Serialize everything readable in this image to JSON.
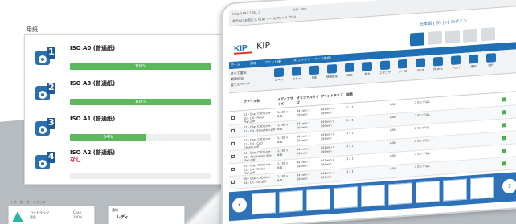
{
  "paper": {
    "title": "用紙",
    "trays": [
      {
        "number": "1",
        "name": "ISO A0 (普通紙)",
        "percent": 100,
        "label": "100%",
        "warning": ""
      },
      {
        "number": "2",
        "name": "ISO A3 (普通紙)",
        "percent": 100,
        "label": "100%",
        "warning": ""
      },
      {
        "number": "3",
        "name": "ISO A1 (普通紙)",
        "percent": 54,
        "label": "54%",
        "warning": ""
      },
      {
        "number": "4",
        "name": "ISO A2 (普通紙)",
        "percent": 0,
        "label": "",
        "warning": "なし"
      }
    ],
    "accent": "#5cb85c"
  },
  "cartridge": {
    "title": "トナー缶・カートリッジ",
    "name": "カートリッジ",
    "sub": "黒色",
    "cyan": "Cyan",
    "cyan_pct": "100%"
  },
  "notice": {
    "title": "通知",
    "status": "レディ"
  },
  "browser": {
    "address": "http://192.168.../",
    "tab": "KIP - Pro...",
    "menu": "表示(V)  お気に入り(A)  ツール(T)  ヘルプ(H)"
  },
  "app": {
    "logo": "KIP",
    "title": "KIP",
    "lang": "日本語 | EN | ▾ | ログイン",
    "tabs": [
      "ホーム",
      "保存",
      "プリント後",
      "ネ ファイル（ページ選択）"
    ],
    "toolbar": [
      "ページ",
      "カラー",
      "分割",
      "詳細設定",
      "回転",
      "拡大",
      "スタンプ",
      "サイズ",
      "VP-Q",
      "PostEx",
      "プロパ",
      "選択",
      "制作"
    ],
    "side": [
      "すべて選択",
      "範囲指定",
      "全てのページ"
    ],
    "headers": [
      "ファイル名",
      "メディアサイズ",
      "オリジナルサイズ",
      "プリントサイズ",
      "部数"
    ],
    "rows": [
      {
        "file": "01 - Gray CAD Line - A0 - D4 - Floor Plan.pdf",
        "media": "1,189 x 841",
        "orig": "841mm x 594mm",
        "print": "841mm x 594mm",
        "copies": "1 x 1",
        "type": "CAD",
        "stamp": "スタンプなし"
      },
      {
        "file": "02 - Gray CAD Line - A1 - D4 - Elevation.pdf",
        "media": "1,189 x 841",
        "orig": "841mm x 594mm",
        "print": "841mm x 594mm",
        "copies": "1 x 1",
        "type": "CAD",
        "stamp": "スタンプなし"
      },
      {
        "file": "03 - Gray CAD Line - A1 - D4 - CAD Details.pdf",
        "media": "1,189 x 841",
        "orig": "841mm x 594mm",
        "print": "841mm x 594mm",
        "copies": "1 x 1",
        "type": "CAD",
        "stamp": "スタンプなし"
      },
      {
        "file": "04 - Gray CAD Line - A1 - Apartment Site Plan.pdf",
        "media": "1,189 x 841",
        "orig": "841mm x 594mm",
        "print": "841mm x 594mm",
        "copies": "1 x 1",
        "type": "CAD",
        "stamp": "スタンプなし"
      },
      {
        "file": "05 - Gray CAD Line - A1 - D4 - Detail Plan.pdf",
        "media": "1,189 x 841",
        "orig": "841mm x 594mm",
        "print": "841mm x 594mm",
        "copies": "1 x 1",
        "type": "CAD",
        "stamp": "スタンプなし"
      },
      {
        "file": "06 - Gray CAD Line - A1 - D5 - GB.pdf",
        "media": "1,189 x 841",
        "orig": "841mm x 594mm",
        "print": "841mm x 594mm",
        "copies": "1 x 1",
        "type": "CAD",
        "stamp": "スタンプなし"
      }
    ],
    "thumb_count": 9,
    "accent": "#1e6fb4"
  }
}
